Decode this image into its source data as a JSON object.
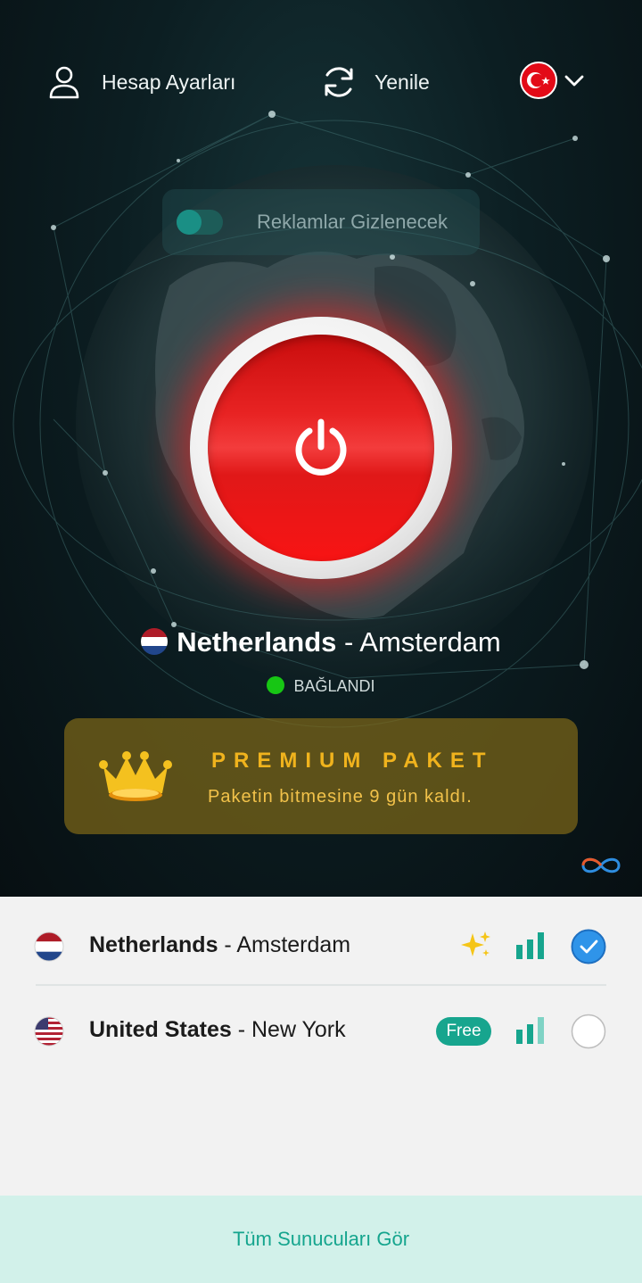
{
  "header": {
    "account_label": "Hesap Ayarları",
    "refresh_label": "Yenile",
    "language_flag": "turkey-flag-icon"
  },
  "ad_toggle": {
    "label": "Reklamlar Gizlenecek",
    "enabled": true
  },
  "connection": {
    "country": "Netherlands",
    "separator": " - ",
    "city": "Amsterdam",
    "status": "BAĞLANDI",
    "status_color": "#17c614",
    "power_color": "#e82323"
  },
  "premium": {
    "title": "PREMIUM PAKET",
    "subtitle": "Paketin bitmesine 9 gün kaldı."
  },
  "servers": [
    {
      "country": "Netherlands",
      "separator": " - ",
      "city": "Amsterdam",
      "badge": "sparkle-icon",
      "selected": true
    },
    {
      "country": "United States",
      "separator": " - ",
      "city": "New York",
      "badge": "Free",
      "selected": false
    }
  ],
  "footer": {
    "all_servers_label": "Tüm Sunucuları Gör"
  },
  "colors": {
    "accent": "#15a58e",
    "premium_gold": "#f0b31d",
    "selected_check": "#2f94e9"
  }
}
